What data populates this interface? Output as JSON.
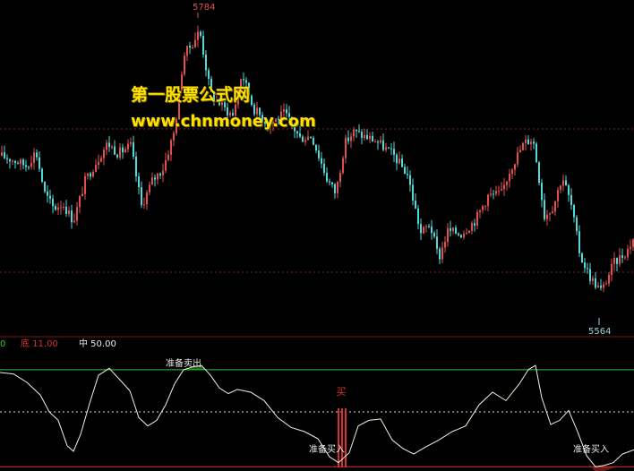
{
  "watermark": {
    "site_name": "第一股票公式网",
    "site_url": "www.chnmoney.com"
  },
  "colors": {
    "background": "#000000",
    "candle_up": "#e05050",
    "candle_down": "#4fd9d9",
    "price_gridline": "#8a2020",
    "indicator_line": "#f2f2e0",
    "upper_band": "#34c734",
    "middle_band": "#d9d9d9",
    "lower_band": "#d83030",
    "label_text": "#e8e8e8",
    "high_label": "#e05050",
    "low_label": "#9ad7e0"
  },
  "chart_data": [
    {
      "type": "candlestick",
      "title": "",
      "annotations": {
        "high": "5784",
        "low": "5564"
      },
      "ylim": [
        5550,
        5800
      ],
      "price_path": [
        [
          0,
          5680
        ],
        [
          10,
          5678
        ],
        [
          20,
          5675
        ],
        [
          30,
          5672
        ],
        [
          40,
          5684
        ],
        [
          50,
          5650
        ],
        [
          60,
          5638
        ],
        [
          70,
          5642
        ],
        [
          82,
          5628
        ],
        [
          95,
          5660
        ],
        [
          108,
          5676
        ],
        [
          120,
          5690
        ],
        [
          132,
          5682
        ],
        [
          146,
          5688
        ],
        [
          158,
          5640
        ],
        [
          170,
          5660
        ],
        [
          182,
          5670
        ],
        [
          195,
          5700
        ],
        [
          205,
          5760
        ],
        [
          215,
          5770
        ],
        [
          223,
          5780
        ],
        [
          235,
          5730
        ],
        [
          250,
          5718
        ],
        [
          260,
          5712
        ],
        [
          270,
          5746
        ],
        [
          283,
          5718
        ],
        [
          300,
          5705
        ],
        [
          318,
          5714
        ],
        [
          335,
          5694
        ],
        [
          348,
          5696
        ],
        [
          365,
          5662
        ],
        [
          375,
          5650
        ],
        [
          385,
          5690
        ],
        [
          395,
          5699
        ],
        [
          405,
          5696
        ],
        [
          420,
          5692
        ],
        [
          440,
          5680
        ],
        [
          455,
          5665
        ],
        [
          470,
          5618
        ],
        [
          480,
          5626
        ],
        [
          490,
          5598
        ],
        [
          500,
          5620
        ],
        [
          515,
          5618
        ],
        [
          530,
          5628
        ],
        [
          545,
          5648
        ],
        [
          560,
          5650
        ],
        [
          570,
          5670
        ],
        [
          585,
          5690
        ],
        [
          595,
          5694
        ],
        [
          600,
          5672
        ],
        [
          608,
          5632
        ],
        [
          618,
          5640
        ],
        [
          628,
          5664
        ],
        [
          638,
          5640
        ],
        [
          648,
          5600
        ],
        [
          660,
          5582
        ],
        [
          672,
          5572
        ],
        [
          685,
          5594
        ],
        [
          700,
          5604
        ],
        [
          708,
          5615
        ]
      ]
    },
    {
      "type": "line",
      "title": "",
      "legend": [
        {
          "label": "0",
          "color": "#34c734"
        },
        {
          "label": "底 11.00",
          "color": "#d83030"
        },
        {
          "label": "中 50.00",
          "color": "#e8e8e8"
        }
      ],
      "levels": {
        "top": 80,
        "middle": 50,
        "bottom": 11
      },
      "ylim": [
        8,
        92
      ],
      "series": [
        {
          "x": [
            0,
            15,
            30,
            45,
            55,
            65,
            75,
            82,
            90,
            100,
            110,
            122,
            135,
            145,
            155,
            165,
            175,
            185,
            195,
            205,
            215,
            225,
            235,
            245,
            255,
            265,
            280,
            295,
            310,
            325,
            340,
            355,
            368,
            378,
            390,
            400,
            412,
            425,
            438,
            450,
            462,
            475,
            490,
            505,
            520,
            535,
            550,
            565,
            580,
            590,
            598,
            605,
            615,
            625,
            635,
            645,
            655,
            665,
            675,
            685,
            695,
            708
          ],
          "y": [
            78,
            77,
            71,
            62,
            50,
            44,
            26,
            22,
            34,
            56,
            76,
            81,
            72,
            65,
            46,
            40,
            44,
            55,
            70,
            80,
            82,
            83,
            76,
            67,
            63,
            66,
            64,
            58,
            46,
            39,
            36,
            31,
            18,
            14,
            21,
            40,
            44,
            45,
            30,
            24,
            20,
            25,
            30,
            36,
            40,
            55,
            64,
            58,
            70,
            80,
            83,
            60,
            41,
            44,
            51,
            36,
            19,
            11,
            12,
            14,
            20,
            23
          ]
        }
      ],
      "signals": [
        {
          "label": "准备卖出",
          "x": 205
        },
        {
          "label": "准备买入",
          "x": 365
        },
        {
          "label": "买",
          "x": 381
        },
        {
          "label": "准备买入",
          "x": 660
        }
      ]
    }
  ]
}
